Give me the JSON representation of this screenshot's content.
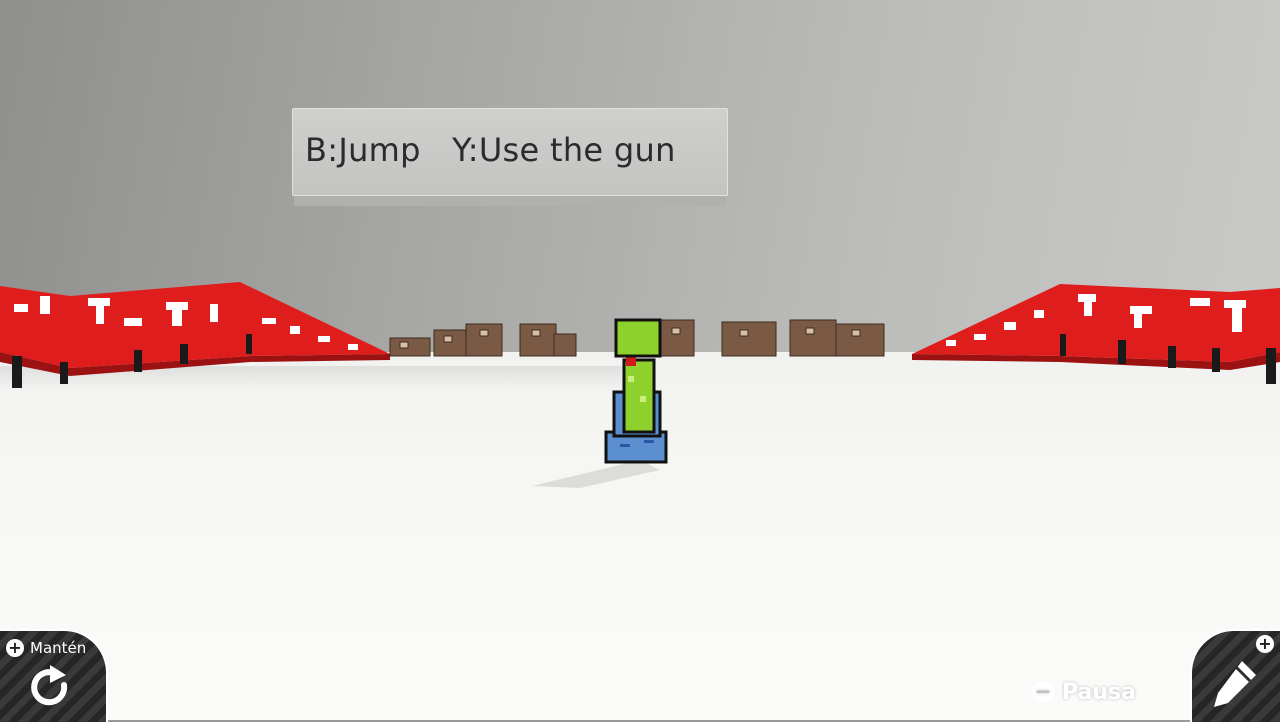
{
  "sign": {
    "text": "B:Jump   Y:Use the gun"
  },
  "hud": {
    "hold_label": "Mantén",
    "plus_symbol": "+",
    "retry_icon": "retry-arrow-icon",
    "edit_icon": "pencil-icon",
    "pause_label": "Pausa",
    "minus_symbol": "−"
  },
  "colors": {
    "banner_red": "#e01d1d",
    "player_green": "#8fd12c",
    "player_blue": "#5b8fd0",
    "crate_brown": "#7a5a44"
  }
}
